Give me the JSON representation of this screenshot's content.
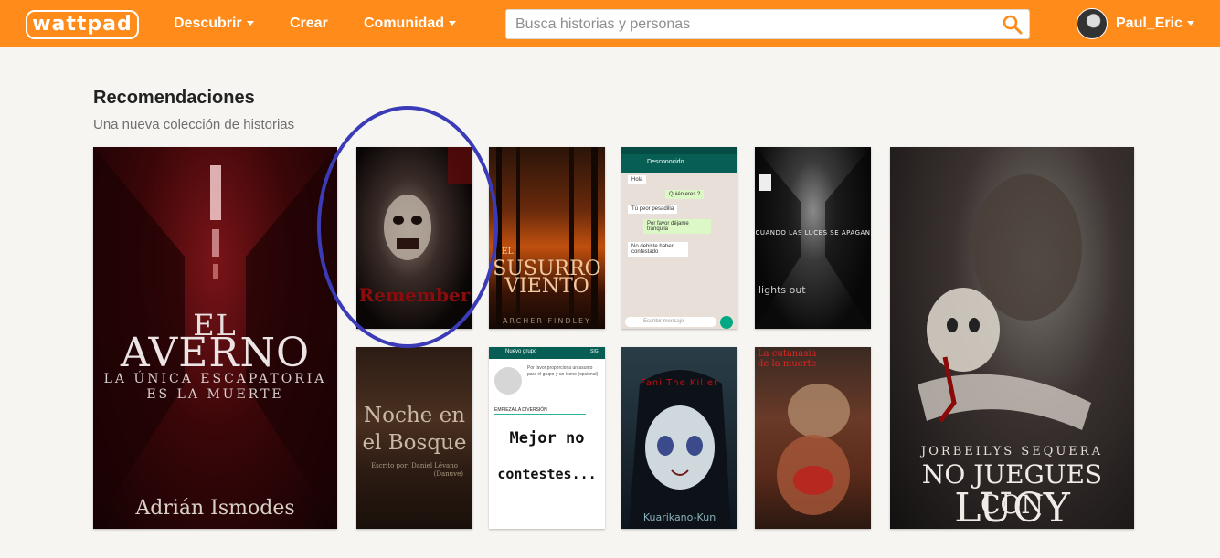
{
  "header": {
    "logo": "wattpad",
    "nav": [
      {
        "label": "Descubrir",
        "dropdown": true
      },
      {
        "label": "Crear",
        "dropdown": false
      },
      {
        "label": "Comunidad",
        "dropdown": true
      }
    ],
    "search_placeholder": "Busca historias y personas",
    "search_icon": "search-icon",
    "username": "Paul_Eric"
  },
  "section": {
    "title": "Recomendaciones",
    "subtitle": "Una nueva colección de historias"
  },
  "covers": {
    "averno": {
      "title_line1": "EL",
      "title_line2": "AVERNO",
      "tagline1": "LA ÚNICA ESCAPATORIA",
      "tagline2": "ES LA MUERTE",
      "author": "Adrián Ismodes"
    },
    "zombie": {
      "title": "Remember"
    },
    "susurro": {
      "title_small": "EL",
      "title_line1": "SUSURRO",
      "title_line2": "VIENTO",
      "title_del": "DEL",
      "author": "ARCHER FINDLEY"
    },
    "chat": {
      "contact": "Desconocido",
      "messages": [
        {
          "text": "Hola",
          "time": "10:15 PM",
          "side": "left"
        },
        {
          "text": "Quién eres ?",
          "time": "10:15 PM",
          "side": "right"
        },
        {
          "text": "Tú peor pesadilla",
          "time": "10:15 PM",
          "side": "left"
        },
        {
          "text": "Por favor déjame tranquila",
          "time": "10:15 PM",
          "side": "right"
        },
        {
          "text": "No debiste haber contestado",
          "time": "10:15 PM",
          "side": "left"
        }
      ],
      "input_placeholder": "Escribir mensaje"
    },
    "luces": {
      "title": "CUANDO LAS LUCES SE APAGAN",
      "subtitle": "lights out"
    },
    "lucy": {
      "author": "JORBEILYS SEQUERA",
      "title_line1": "NO JUEGUES CON",
      "title_line2": "LUCY"
    },
    "bosque": {
      "title_line1": "Noche en",
      "title_line2": "el Bosque",
      "credit1": "Escrito por: Daniel Lévano",
      "credit2": "(Danuve)"
    },
    "grupo": {
      "header": "Nuevo grupo",
      "header_action": "SIG.",
      "hint": "Por favor proporciona un asunto para el grupo y un ícono (opcional)",
      "group_name": "EMPIEZA LA DIVERSIÓN",
      "title_line1": "Mejor no",
      "title_line2": "contestes..."
    },
    "fani": {
      "title": "Fani The Killer",
      "author": "Kuarikano-Kun"
    },
    "cutanasia": {
      "title_line1": "La cutanasia",
      "title_line2": "de la muerte"
    }
  }
}
